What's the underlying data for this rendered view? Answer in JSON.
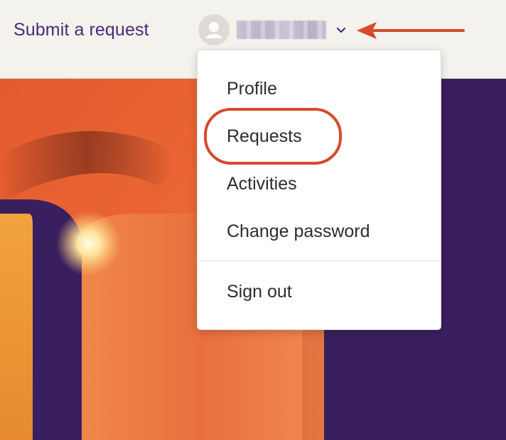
{
  "header": {
    "submit_link": "Submit a request",
    "avatar_icon": "user-avatar-icon",
    "chevron_icon": "chevron-down-icon",
    "username": ""
  },
  "annotation": {
    "arrow_color": "#d54a2b",
    "highlight_color": "#d54a2b"
  },
  "menu": {
    "items": [
      {
        "label": "Profile"
      },
      {
        "label": "Requests"
      },
      {
        "label": "Activities"
      },
      {
        "label": "Change password"
      },
      {
        "label": "Sign out"
      }
    ]
  },
  "colors": {
    "brand_purple": "#3b1f5e",
    "link_purple": "#4a2c7a",
    "header_bg": "#f3f2ec",
    "hero_orange": "#e8713a"
  }
}
